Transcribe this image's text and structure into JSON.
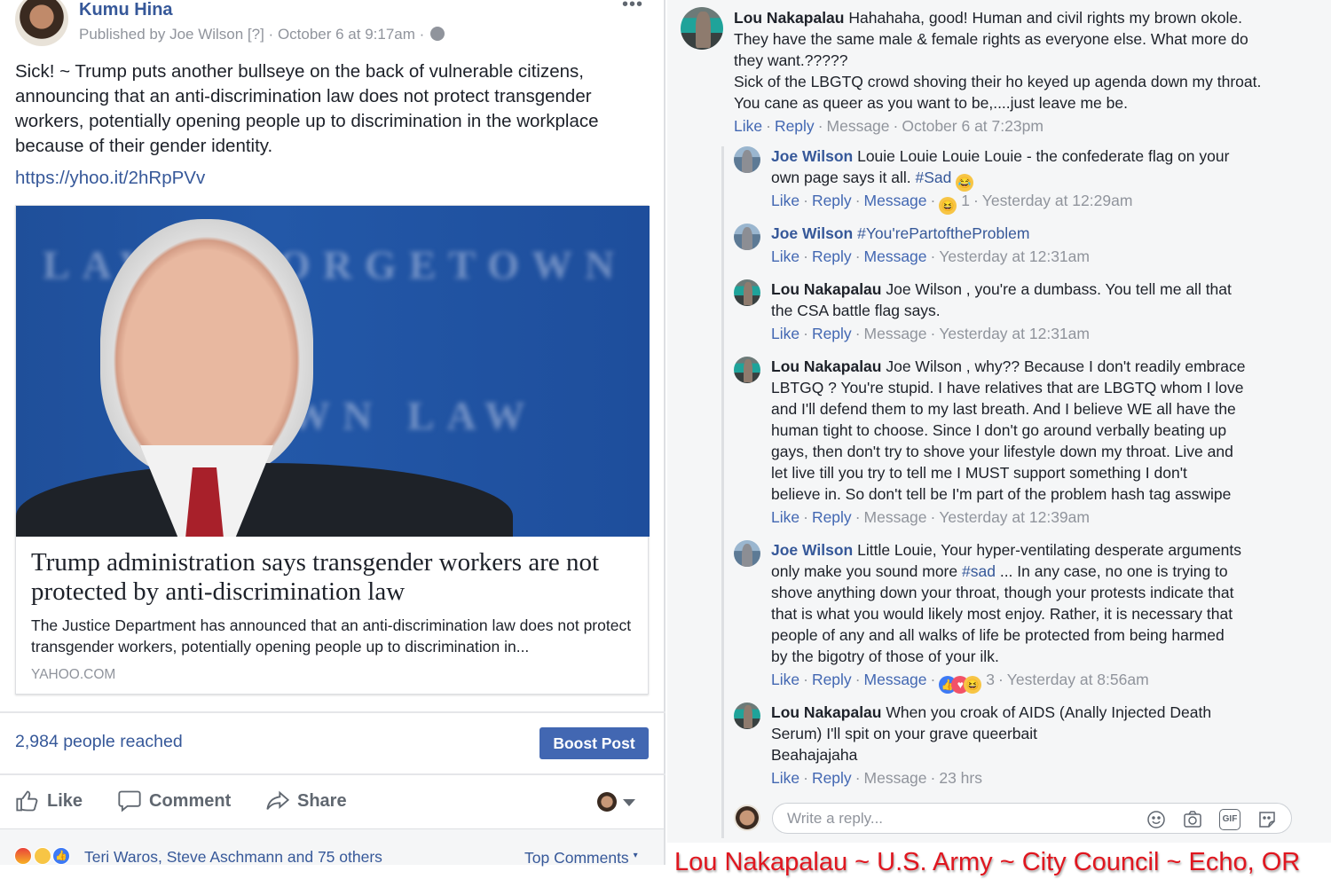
{
  "post": {
    "author": "Kumu Hina",
    "meta": "Published by Joe Wilson [?] · October 6 at 9:17am ·",
    "more_icon": "•••",
    "text": "Sick! ~ Trump puts another bullseye on the back of vulnerable citizens, announcing that an anti-discrimination law does not protect transgender workers, potentially opening people up to discrimination in the workplace because of their gender identity.",
    "link": "https://yhoo.it/2hRpPVv",
    "card": {
      "image_bg_text_top": "LAW GEORGETOWN",
      "image_bg_text_bottom": "GETOWN LAW",
      "title": "Trump administration says transgender workers are not protected by anti-discrimination law",
      "description": "The Justice Department has announced that an anti-discrimination law does not protect transgender workers, potentially opening people up to discrimination in...",
      "domain": "YAHOO.COM"
    },
    "reach": "2,984 people reached",
    "boost_label": "Boost Post",
    "actions": {
      "like": "Like",
      "comment": "Comment",
      "share": "Share"
    },
    "reactions": {
      "names": "Teri Waros, Steve Aschmann and 75 others",
      "sort_label": "Top Comments",
      "types": [
        "angry",
        "sad",
        "like"
      ]
    }
  },
  "comments": [
    {
      "name": "Lou Nakapalau",
      "lines": [
        "Hahahaha, good! Human and civil rights my brown okole.",
        "They have the same male & female rights as everyone else. What more do",
        "they want.?????",
        "Sick of the LBGTQ crowd shoving their ho keyed up agenda down my throat.",
        "You cane as queer as you want to be,....just leave me be."
      ],
      "like": "Like",
      "reply": "Reply",
      "message": "Message",
      "time": "October 6 at 7:23pm"
    },
    {
      "name": "Joe Wilson",
      "text_1": "Louie Louie Louie Louie - the confederate flag on your",
      "text_2": "own page says it all.",
      "hashtag": "#Sad",
      "like": "Like",
      "reply": "Reply",
      "message": "Message",
      "reaction_count": "1",
      "time": "Yesterday at 12:29am"
    },
    {
      "name": "Joe Wilson",
      "hashtag": "#You'rePartoftheProblem",
      "like": "Like",
      "reply": "Reply",
      "message": "Message",
      "time": "Yesterday at 12:31am"
    },
    {
      "name": "Lou Nakapalau",
      "lines": [
        "Joe Wilson , you're a dumbass. You tell me all that",
        "the CSA battle flag says."
      ],
      "like": "Like",
      "reply": "Reply",
      "message": "Message",
      "time": "Yesterday at 12:31am"
    },
    {
      "name": "Lou Nakapalau",
      "lines": [
        "Joe Wilson , why?? Because I don't readily embrace",
        "LBTGQ ? You're stupid. I have relatives that are LBGTQ whom I love",
        "and I'll defend them to my last breath. And I believe WE all have the",
        "human tight to choose. Since I don't go around verbally beating up",
        "gays, then don't try to shove your lifestyle down my throat. Live and",
        "let live till you try to tell me I MUST support something I don't",
        "believe in. So don't tell be I'm part of the problem hash tag asswipe"
      ],
      "like": "Like",
      "reply": "Reply",
      "message": "Message",
      "time": "Yesterday at 12:39am"
    },
    {
      "name": "Joe Wilson",
      "line_1": "Little Louie, Your hyper-ventilating desperate arguments",
      "line_2_pre": "only make you sound more",
      "hashtag": "#sad",
      "line_2_post": "... In any case, no one is trying to",
      "lines_rest": [
        "shove anything down your throat, though your protests indicate that",
        "that is what you would likely most enjoy. Rather, it is necessary that",
        "people of any and all walks of life be protected from being harmed",
        "by the bigotry of those of your ilk."
      ],
      "like": "Like",
      "reply": "Reply",
      "message": "Message",
      "reaction_count": "3",
      "time": "Yesterday at 8:56am"
    },
    {
      "name": "Lou Nakapalau",
      "lines": [
        "When you croak of AIDS (Anally Injected Death",
        "Serum) I'll spit on your grave queerbait",
        "Beahajajaha"
      ],
      "like": "Like",
      "reply": "Reply",
      "message": "Message",
      "time": "23 hrs"
    }
  ],
  "reply_box": {
    "placeholder": "Write a reply...",
    "icons": [
      "emoji-icon",
      "camera-icon",
      "gif-icon",
      "sticker-icon"
    ],
    "gif_label": "GIF"
  },
  "caption": "Lou Nakapalau ~ U.S. Army ~ City Council ~ Echo, OR",
  "colors": {
    "link_blue": "#365899",
    "button_blue": "#4267b2",
    "meta_gray": "#90949c",
    "caption_red": "#e0161f"
  }
}
